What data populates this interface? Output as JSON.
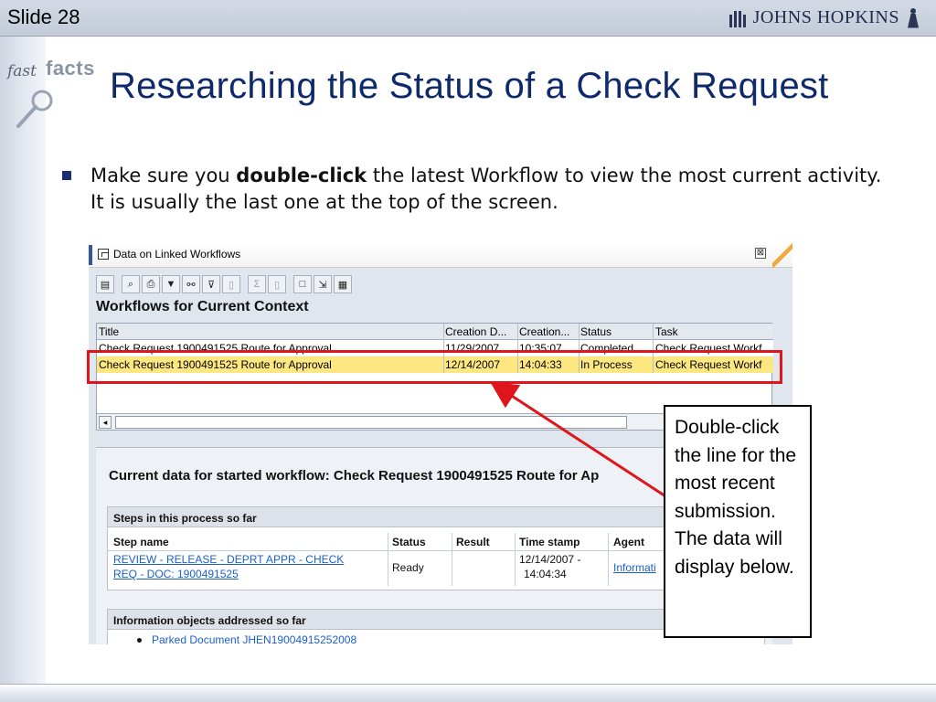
{
  "slide": {
    "number_label": "Slide 28"
  },
  "brand": {
    "logo_text": "JOHNS HOPKINS"
  },
  "fastfacts": {
    "fast": "fast",
    "facts": "facts"
  },
  "title": "Researching the Status of a Check Request",
  "bullet": {
    "before": "Make sure you ",
    "bold": "double-click",
    "after": " the latest Workflow to view the most current activity. It is usually the last one at the top of the screen."
  },
  "sap": {
    "window_title": "Data on Linked Workflows",
    "close_symbol": "⊠",
    "section_title": "Workflows for Current Context",
    "toolbar_icons": [
      "details-icon",
      "find-icon",
      "print-icon",
      "filter-icon",
      "binoculars-icon",
      "set-filter-icon",
      "info-icon",
      "sum-icon",
      "subtotal-icon",
      "print-preview-icon",
      "export-icon",
      "grid-icon"
    ],
    "columns": [
      "Title",
      "Creation D...",
      "Creation...",
      "Status",
      "Task"
    ],
    "rows": [
      {
        "title": "Check Request 1900491525  Route for Approval",
        "date": "11/29/2007",
        "time": "10:35:07",
        "status": "Completed",
        "task": "Check Request Workf"
      },
      {
        "title": "Check Request 1900491525  Route for Approval",
        "date": "12/14/2007",
        "time": "14:04:33",
        "status": "In Process",
        "task": "Check Request Workf"
      }
    ],
    "scroll_left": "◂",
    "detail": {
      "title": "Current data for started workflow: Check Request 1900491525 Route for Ap",
      "steps_header": "Steps in this process so far",
      "step_columns": [
        "Step name",
        "Status",
        "Result",
        "Time stamp",
        "Agent"
      ],
      "step": {
        "name_line1": "REVIEW - RELEASE - DEPRT APPR - CHECK",
        "name_line2": "REQ - DOC: 1900491525",
        "status": "Ready",
        "result": "",
        "time_line1": "12/14/2007 -",
        "time_line2": "14:04:34",
        "agent": "Informati"
      },
      "info_header": "Information objects addressed so far",
      "info_item": "Parked Document JHEN19004915252008"
    }
  },
  "callout": "Double-click the line for the most recent submission. The data will display below.",
  "colors": {
    "title_blue": "#0f2a6b",
    "highlight_red": "#e0151b",
    "row_yellow": "#fde780",
    "link_blue": "#1a5fd0"
  }
}
